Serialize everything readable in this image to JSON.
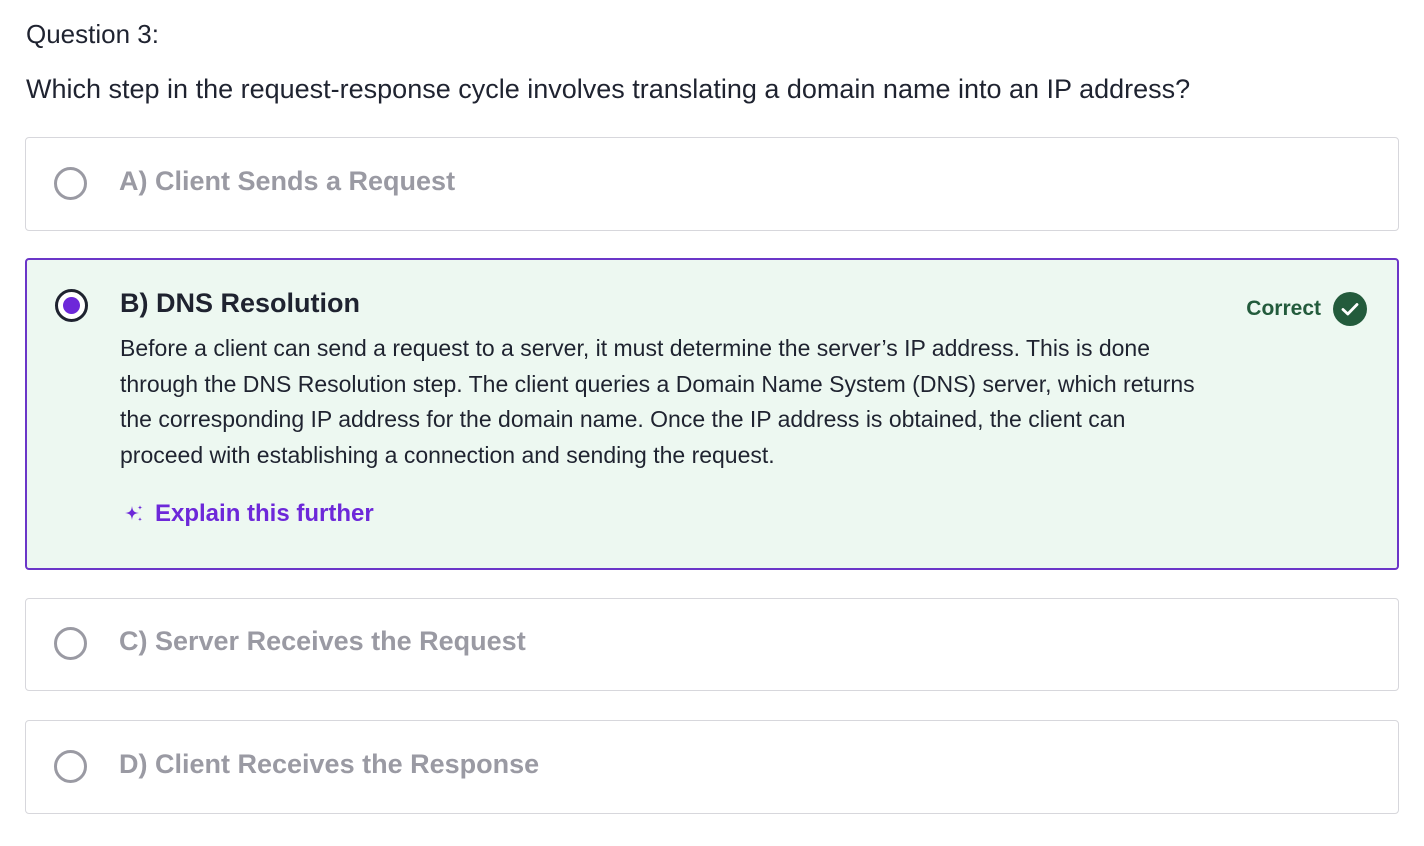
{
  "question": {
    "number_label": "Question 3:",
    "text": "Which step in the request-response cycle involves translating a domain name into an IP address?"
  },
  "options": [
    {
      "label": "A) Client Sends a Request",
      "selected": false
    },
    {
      "label": "B) DNS Resolution",
      "selected": true,
      "status": "Correct",
      "status_icon": "check-circle-icon",
      "feedback": "Before a client can send a request to a server, it must determine the server’s IP address. This is done through the DNS Resolution step. The client queries a Domain Name System (DNS) server, which returns the corresponding IP address for the domain name. Once the IP address is obtained, the client can proceed with establishing a connection and sending the request.",
      "explain_label": "Explain this further",
      "explain_icon": "sparkle-icon"
    },
    {
      "label": "C) Server Receives the Request",
      "selected": false
    },
    {
      "label": "D) Client Receives the Response",
      "selected": false
    }
  ],
  "colors": {
    "accent_purple": "#6d28d9",
    "selected_border": "#6b36c8",
    "selected_background": "#edf8f1",
    "correct_green": "#235b3c",
    "muted_text": "#9a9aa3",
    "primary_text": "#1f2330"
  }
}
